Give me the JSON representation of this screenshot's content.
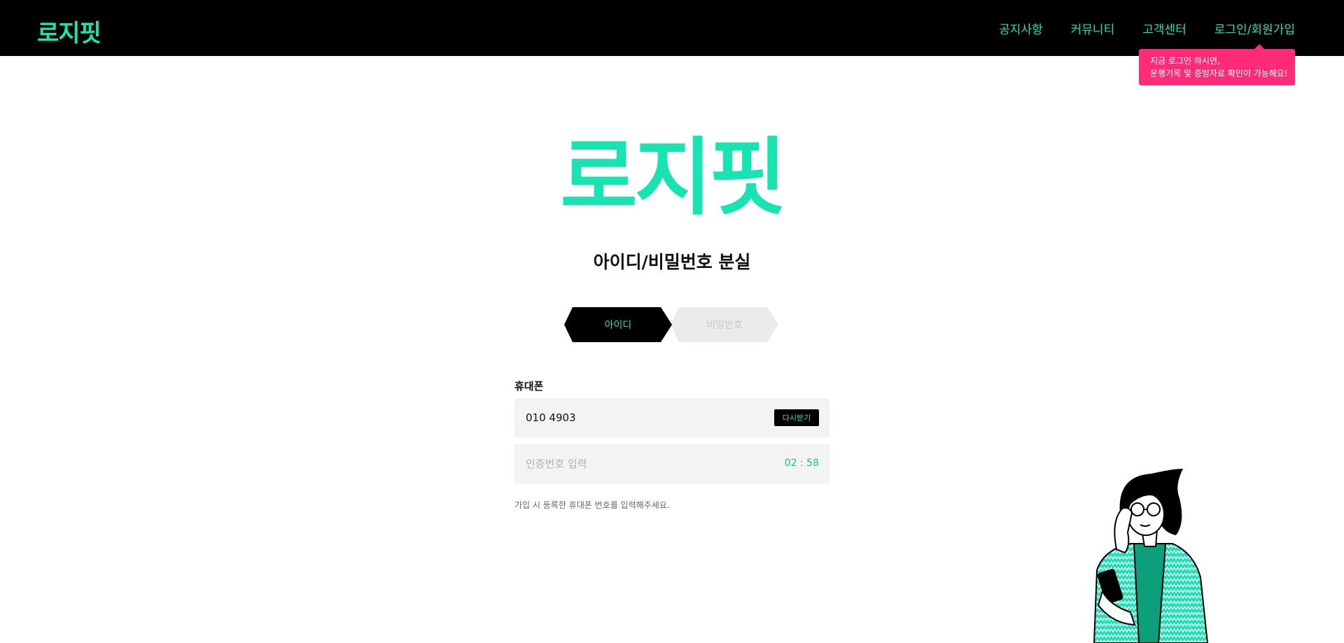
{
  "header": {
    "logo": "로지핏",
    "nav": [
      "공지사항",
      "커뮤니티",
      "고객센터",
      "로그인/회원가입"
    ]
  },
  "tooltip": {
    "line1": "지금 로그인 하시면,",
    "line2": "운행기록 및 증빙자료 확인이 가능해요!"
  },
  "main": {
    "logo": "로지핏",
    "title": "아이디/비밀번호 분실",
    "tabs": [
      "아이디",
      "비밀번호"
    ],
    "active_tab": "아이디",
    "phone_label": "휴대폰",
    "phone_value": "010 4903",
    "resend_label": "다시받기",
    "code_placeholder": "인증번호 입력",
    "timer": "02 : 58",
    "hint": "가입 시 등록한 휴대폰 번호를 입력해주세요."
  },
  "colors": {
    "brand": "#19e3b3",
    "tooltip": "#ff2b77",
    "header_bg": "#000000"
  }
}
